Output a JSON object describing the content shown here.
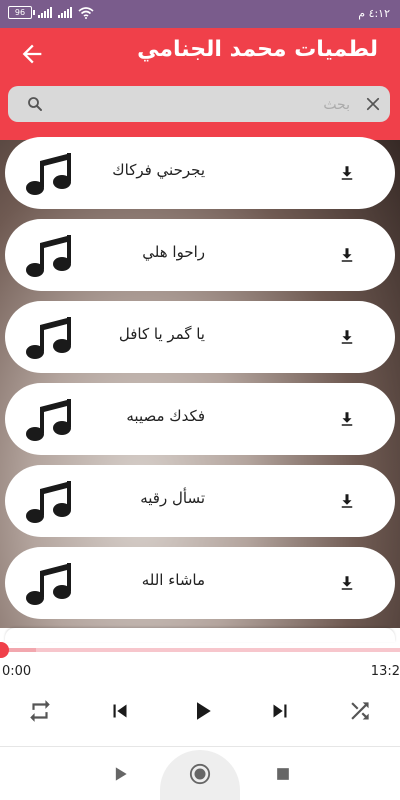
{
  "status_bar": {
    "battery": "96",
    "time": "٤:١٢ م"
  },
  "header": {
    "title": "لطميات محمد الجنامي"
  },
  "search": {
    "placeholder": "بحث",
    "value": ""
  },
  "songs": [
    {
      "title": "يجرحني فركاك"
    },
    {
      "title": "راحوا هلي"
    },
    {
      "title": "يا گمر يا كافل"
    },
    {
      "title": "فكدك مصيبه"
    },
    {
      "title": "تسأل رقيه"
    },
    {
      "title": "ماشاء الله"
    }
  ],
  "player": {
    "current_time": "0:00",
    "total_time": "13:2",
    "progress": 0.0,
    "buffered": 0.09
  },
  "colors": {
    "accent": "#f0404a",
    "status_bar": "#7a5c8c",
    "icon": "#1a1a1a",
    "control_icon": "#555555"
  },
  "icons": {
    "back": "arrow-left-icon",
    "search": "search-icon",
    "clear": "close-icon",
    "song": "music-note-icon",
    "download": "download-icon",
    "repeat": "repeat-icon",
    "previous": "skip-previous-icon",
    "play": "play-icon",
    "next": "skip-next-icon",
    "shuffle": "shuffle-icon",
    "rec_play": "play-icon",
    "rec_record": "record-icon",
    "rec_stop": "stop-icon"
  }
}
